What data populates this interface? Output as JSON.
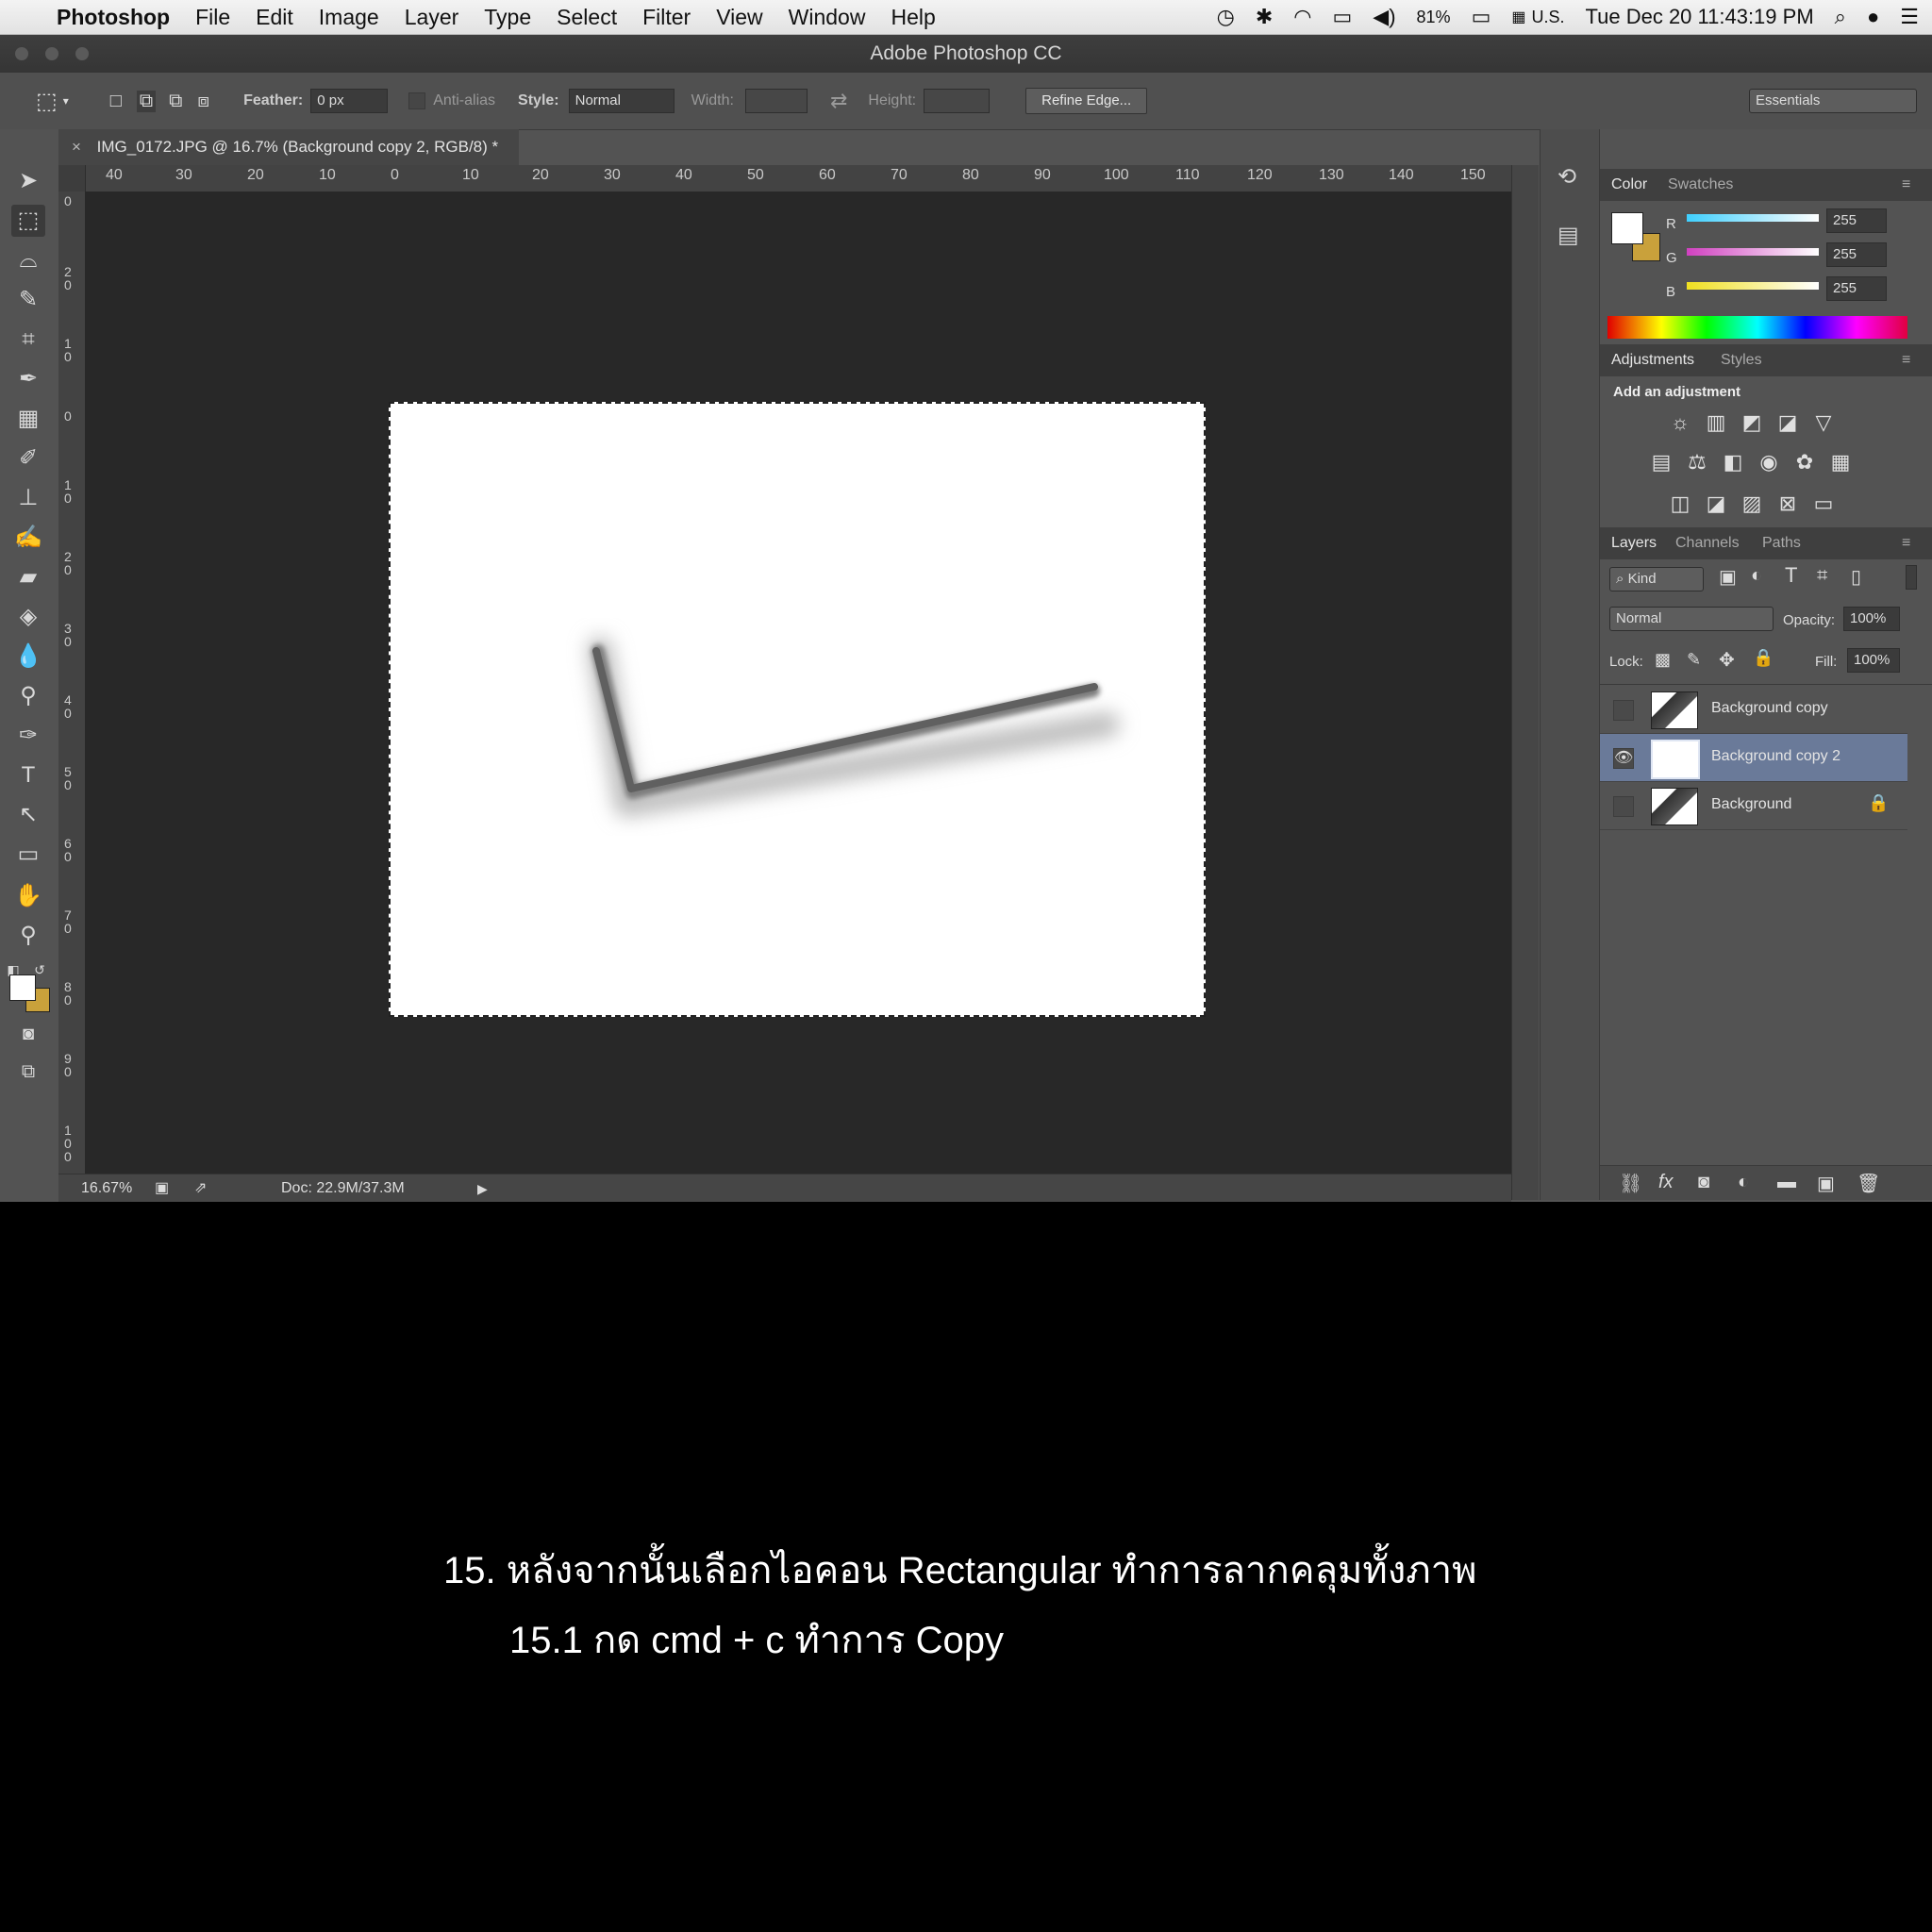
{
  "menubar": {
    "app": "Photoshop",
    "items": [
      "File",
      "Edit",
      "Image",
      "Layer",
      "Type",
      "Select",
      "Filter",
      "View",
      "Window",
      "Help"
    ],
    "battery": "81%",
    "input_source": "U.S.",
    "datetime": "Tue Dec 20  11:43:19 PM"
  },
  "window": {
    "title": "Adobe Photoshop CC"
  },
  "options": {
    "feather_label": "Feather:",
    "feather_value": "0 px",
    "antialias_label": "Anti-alias",
    "style_label": "Style:",
    "style_value": "Normal",
    "width_label": "Width:",
    "height_label": "Height:",
    "refine_label": "Refine Edge...",
    "workspace": "Essentials"
  },
  "document": {
    "tab_title": "IMG_0172.JPG @ 16.7% (Background copy 2, RGB/8) *",
    "ruler_labels": [
      "40",
      "30",
      "20",
      "10",
      "0",
      "10",
      "20",
      "30",
      "40",
      "50",
      "60",
      "70",
      "80",
      "90",
      "100",
      "110",
      "120",
      "130",
      "140",
      "150"
    ],
    "vruler_labels": [
      "0",
      "2 0",
      "1 0",
      "0",
      "1 0",
      "2 0",
      "3 0",
      "4 0",
      "5 0",
      "6 0",
      "7 0",
      "8 0",
      "9 0",
      "1 0 0",
      "1"
    ]
  },
  "status": {
    "zoom": "16.67%",
    "doc": "Doc: 22.9M/37.3M"
  },
  "color_panel": {
    "tabs": [
      "Color",
      "Swatches"
    ],
    "r_label": "R",
    "r_value": "255",
    "g_label": "G",
    "g_value": "255",
    "b_label": "B",
    "b_value": "255",
    "foreground": "#ffffff",
    "background": "#c9a13b"
  },
  "adjustments_panel": {
    "tabs": [
      "Adjustments",
      "Styles"
    ],
    "heading": "Add an adjustment"
  },
  "layers_panel": {
    "tabs": [
      "Layers",
      "Channels",
      "Paths"
    ],
    "filter_kind": "Kind",
    "blend_mode": "Normal",
    "opacity_label": "Opacity:",
    "opacity_value": "100%",
    "lock_label": "Lock:",
    "fill_label": "Fill:",
    "fill_value": "100%",
    "layers": [
      {
        "name": "Background copy",
        "visible": false,
        "selected": false
      },
      {
        "name": "Background copy 2",
        "visible": true,
        "selected": true
      },
      {
        "name": "Background",
        "visible": false,
        "selected": false,
        "locked": true
      }
    ]
  },
  "caption": {
    "line1": "15. หลังจากนั้นเลือกไอคอน Rectangular ทำการลากคลุมทั้งภาพ",
    "line2": "15.1 กด cmd + c ทำการ Copy"
  }
}
